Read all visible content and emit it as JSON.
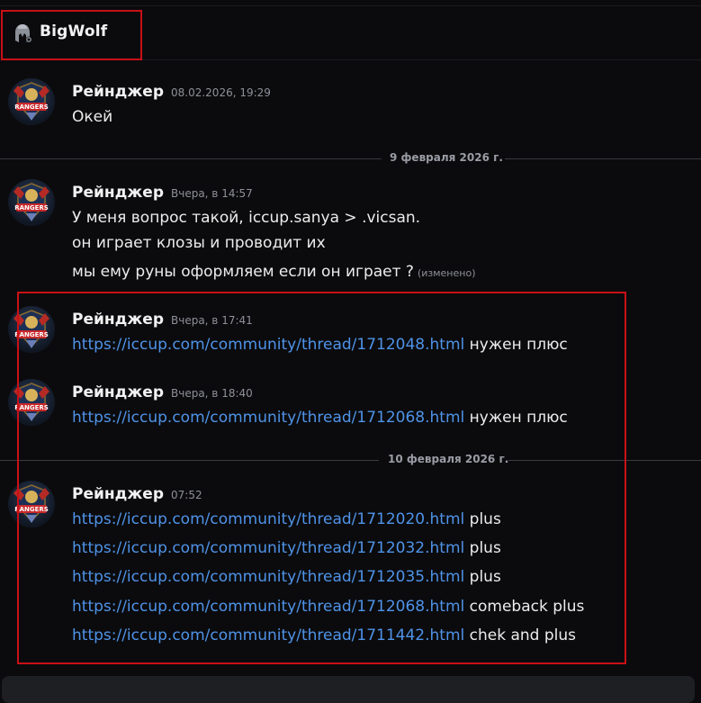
{
  "header": {
    "title": "BigWolf",
    "icon": "helmet-icon"
  },
  "messages": [
    {
      "author": "Рейнджер",
      "time": "08.02.2026, 19:29",
      "lines": [
        {
          "text": "Окей"
        }
      ]
    },
    {
      "author": "Рейнджер",
      "time": "Вчера, в 14:57",
      "lines": [
        {
          "text": "У меня вопрос такой, iccup.sanya > .vicsan."
        },
        {
          "text": "он играет клозы  и проводит их"
        },
        {
          "text": "мы ему руны оформляем если он играет ?",
          "edited": "(изменено)"
        }
      ]
    },
    {
      "author": "Рейнджер",
      "time": "Вчера, в 17:41",
      "lines": [
        {
          "link": "https://iccup.com/community/thread/1712048.html",
          "text": "нужен плюс"
        }
      ]
    },
    {
      "author": "Рейнджер",
      "time": "Вчера, в 18:40",
      "lines": [
        {
          "link": "https://iccup.com/community/thread/1712068.html",
          "text": "нужен плюс"
        }
      ]
    },
    {
      "author": "Рейнджер",
      "time": "07:52",
      "lines": [
        {
          "link": "https://iccup.com/community/thread/1712020.html",
          "text": "plus"
        },
        {
          "link": "https://iccup.com/community/thread/1712032.html",
          "text": "plus"
        },
        {
          "link": "https://iccup.com/community/thread/1712035.html",
          "text": "plus"
        },
        {
          "link": "https://iccup.com/community/thread/1712068.html",
          "text": "comeback plus"
        },
        {
          "link": "https://iccup.com/community/thread/1711442.html",
          "text": "chek and plus"
        }
      ]
    }
  ],
  "dividers": [
    "9 февраля 2026 г.",
    "10 февраля 2026 г."
  ],
  "avatar_text": "RANGERS",
  "colors": {
    "background": "#0b0b0d",
    "link": "#4f93e8",
    "highlight": "#c81017"
  }
}
